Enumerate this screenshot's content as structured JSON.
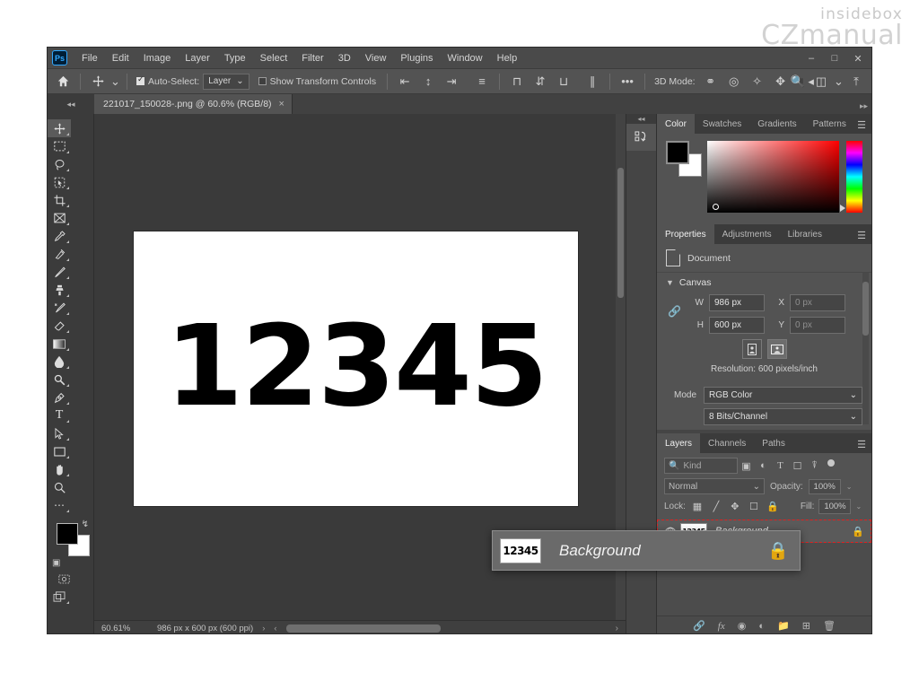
{
  "watermark": {
    "line1": "insidebox",
    "line2": "CZmanual"
  },
  "menubar": {
    "logo": "Ps",
    "items": [
      "File",
      "Edit",
      "Image",
      "Layer",
      "Type",
      "Select",
      "Filter",
      "3D",
      "View",
      "Plugins",
      "Window",
      "Help"
    ],
    "window_controls": [
      "minimize-icon",
      "maximize-icon",
      "close-icon"
    ]
  },
  "options_bar": {
    "home_icon": "home-icon",
    "tool_icon": "move-tool-icon",
    "auto_select_label": "Auto-Select:",
    "auto_select_checked": true,
    "layer_select_value": "Layer",
    "show_transform_label": "Show Transform Controls",
    "show_transform_checked": false,
    "align_icons": [
      "align-left-icon",
      "align-center-h-icon",
      "align-right-icon",
      "distribute-icon"
    ],
    "dist_icons": [
      "align-top-icon",
      "align-middle-icon",
      "align-bottom-icon",
      "distribute-v-icon"
    ],
    "more_label": "•••",
    "mode_3d_label": "3D Mode:",
    "mode_3d_icons": [
      "orbit-3d-icon",
      "roll-3d-icon",
      "pan-3d-icon",
      "slide-3d-icon",
      "camera-3d-icon"
    ],
    "right_icons": [
      "search-icon",
      "arrange-documents-icon",
      "chevron-down-icon",
      "share-icon"
    ]
  },
  "tabbar": {
    "collapse_icon": "collapse-panel-icon",
    "doc_title": "221017_150028-.png @ 60.6% (RGB/8)",
    "close_label": "×",
    "expand_icon": "expand-icon"
  },
  "toolbar": {
    "tools": [
      {
        "name": "move-tool",
        "selected": true
      },
      {
        "name": "rectangular-marquee-tool",
        "selected": false
      },
      {
        "name": "lasso-tool",
        "selected": false
      },
      {
        "name": "object-selection-tool",
        "selected": false
      },
      {
        "name": "crop-tool",
        "selected": false
      },
      {
        "name": "frame-tool",
        "selected": false
      },
      {
        "name": "eyedropper-tool",
        "selected": false
      },
      {
        "name": "spot-healing-brush-tool",
        "selected": false
      },
      {
        "name": "brush-tool",
        "selected": false
      },
      {
        "name": "clone-stamp-tool",
        "selected": false
      },
      {
        "name": "history-brush-tool",
        "selected": false
      },
      {
        "name": "eraser-tool",
        "selected": false
      },
      {
        "name": "gradient-tool",
        "selected": false
      },
      {
        "name": "blur-tool",
        "selected": false
      },
      {
        "name": "dodge-tool",
        "selected": false
      },
      {
        "name": "pen-tool",
        "selected": false
      },
      {
        "name": "horizontal-type-tool",
        "selected": false
      },
      {
        "name": "path-selection-tool",
        "selected": false
      },
      {
        "name": "rectangle-tool",
        "selected": false
      },
      {
        "name": "hand-tool",
        "selected": false
      },
      {
        "name": "zoom-tool",
        "selected": false
      },
      {
        "name": "edit-toolbar-tool",
        "selected": false
      }
    ],
    "foreground_color": "#000000",
    "background_color": "#ffffff",
    "bottom_icons": [
      "quick-mask-icon",
      "screen-mode-icon"
    ]
  },
  "canvas": {
    "document_text": "12345",
    "background_color": "#ffffff"
  },
  "statusbar": {
    "zoom": "60.61%",
    "dimensions": "986 px x 600 px (600 ppi)",
    "arrow": "›",
    "chevron": "‹"
  },
  "strip_panel": {
    "icon": "history-actions-icon"
  },
  "color_panel": {
    "tabs": [
      {
        "label": "Color",
        "active": true
      },
      {
        "label": "Swatches",
        "active": false
      },
      {
        "label": "Gradients",
        "active": false
      },
      {
        "label": "Patterns",
        "active": false
      }
    ],
    "menu_icon": "panel-menu-icon",
    "foreground": "#000000",
    "background": "#ffffff"
  },
  "properties_panel": {
    "tabs": [
      {
        "label": "Properties",
        "active": true
      },
      {
        "label": "Adjustments",
        "active": false
      },
      {
        "label": "Libraries",
        "active": false
      }
    ],
    "menu_icon": "panel-menu-icon",
    "header_icon": "document-icon",
    "header_label": "Document",
    "section_title": "Canvas",
    "w_label": "W",
    "w_value": "986 px",
    "h_label": "H",
    "h_value": "600 px",
    "x_label": "X",
    "x_value": "0 px",
    "y_label": "Y",
    "y_value": "0 px",
    "link_icon": "link-dimensions-icon",
    "orientation": [
      {
        "name": "portrait-icon",
        "active": false
      },
      {
        "name": "landscape-icon",
        "active": true
      }
    ],
    "resolution": "Resolution: 600 pixels/inch",
    "mode_label": "Mode",
    "mode_value": "RGB Color",
    "depth_value": "8 Bits/Channel"
  },
  "layers_panel": {
    "tabs": [
      {
        "label": "Layers",
        "active": true
      },
      {
        "label": "Channels",
        "active": false
      },
      {
        "label": "Paths",
        "active": false
      }
    ],
    "menu_icon": "panel-menu-icon",
    "filter_label": "Kind",
    "filter_icons": [
      "filter-pixel-icon",
      "filter-adjustment-icon",
      "filter-type-icon",
      "filter-shape-icon",
      "filter-smart-icon"
    ],
    "filter_toggle": "filter-enable-toggle",
    "blend_mode": "Normal",
    "opacity_label": "Opacity:",
    "opacity_value": "100%",
    "lock_label": "Lock:",
    "lock_icons": [
      "lock-transparent-icon",
      "lock-image-icon",
      "lock-position-icon",
      "lock-artboard-icon",
      "lock-all-icon"
    ],
    "fill_label": "Fill:",
    "fill_value": "100%",
    "rows": [
      {
        "visibility_icon": "eye-icon",
        "thumbnail_text": "12345",
        "name": "Background",
        "lock_icon": "lock-icon",
        "selected": true,
        "highlight_color": "#e02020"
      }
    ],
    "bottom_icons": [
      "link-layers-icon",
      "layer-style-fx-icon",
      "add-mask-icon",
      "adjustment-layer-icon",
      "new-group-icon",
      "new-layer-icon",
      "delete-layer-icon"
    ]
  },
  "callout": {
    "thumbnail_text": "12345",
    "name": "Background",
    "lock_icon": "lock-icon"
  }
}
